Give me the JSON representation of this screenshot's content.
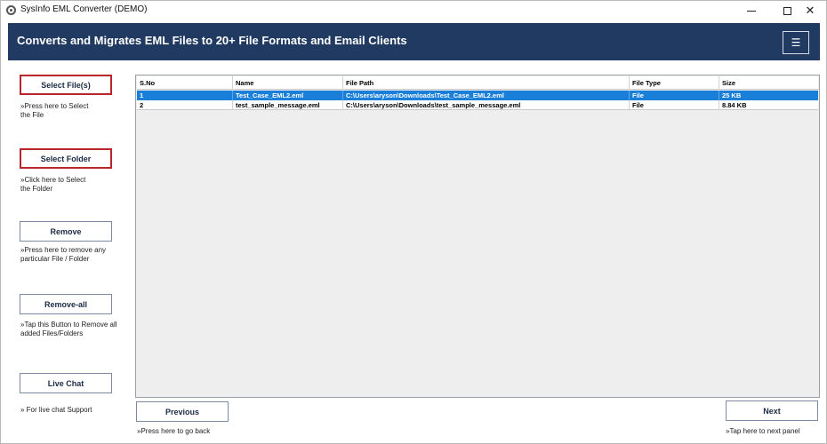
{
  "window": {
    "title": "SysInfo EML Converter (DEMO)",
    "minimize_glyph": "",
    "close_glyph": "✕"
  },
  "header": {
    "title": "Converts and Migrates EML Files to 20+ File Formats and Email Clients",
    "menu_glyph": "☰",
    "background_color": "#203a61"
  },
  "sidebar": {
    "select_files": {
      "label": "Select File(s)",
      "hint_line1": "»Press here to Select",
      "hint_line2": "the File"
    },
    "select_folder": {
      "label": "Select Folder",
      "hint_line1": "»Click here to Select",
      "hint_line2": "the Folder"
    },
    "remove": {
      "label": "Remove",
      "hint_line1": "»Press here to remove any",
      "hint_line2": "particular File / Folder"
    },
    "remove_all": {
      "label": "Remove-all",
      "hint_line1": "»Tap this Button to Remove all",
      "hint_line2": "added Files/Folders"
    },
    "live_chat": {
      "label": "Live Chat",
      "hint_line1": "» For live chat Support"
    }
  },
  "table": {
    "columns": [
      "S.No",
      "Name",
      "File Path",
      "File Type",
      "Size"
    ],
    "rows": [
      {
        "sno": "1",
        "name": "Test_Case_EML2.eml",
        "path": "C:\\Users\\aryson\\Downloads\\Test_Case_EML2.eml",
        "type": "File",
        "size": "25 KB",
        "selected": true
      },
      {
        "sno": "2",
        "name": "test_sample_message.eml",
        "path": "C:\\Users\\aryson\\Downloads\\test_sample_message.eml",
        "type": "File",
        "size": "8.84 KB",
        "selected": false
      }
    ],
    "selection_color": "#1a7fd8"
  },
  "footer": {
    "previous": {
      "label": "Previous",
      "hint": "»Press here to go back"
    },
    "next": {
      "label": "Next",
      "hint": "»Tap here to next panel"
    }
  },
  "icons": {
    "app": "app-logo-icon",
    "menu": "hamburger-menu-icon"
  }
}
